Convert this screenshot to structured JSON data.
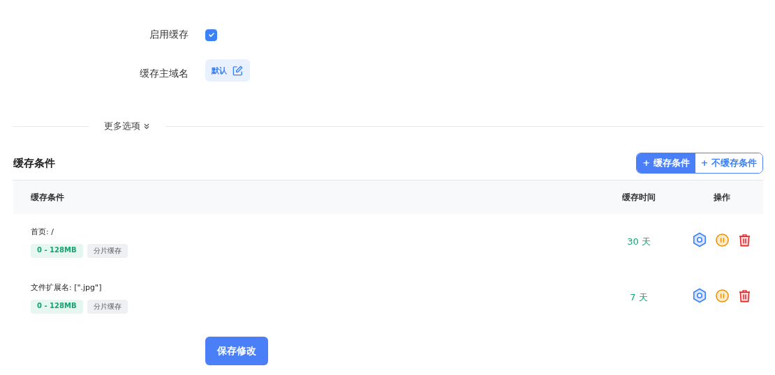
{
  "form": {
    "enable_cache": {
      "label": "启用缓存",
      "checked": true
    },
    "cache_host": {
      "label": "缓存主域名",
      "value": "默认"
    }
  },
  "more_options": {
    "label": "更多选项",
    "expanded": false
  },
  "section": {
    "title": "缓存条件",
    "buttons": [
      {
        "label": "+ 缓存条件",
        "selected": true
      },
      {
        "label": "+ 不缓存条件",
        "selected": false
      }
    ]
  },
  "table": {
    "columns": [
      "缓存条件",
      "缓存时间",
      "操作"
    ],
    "rows": [
      {
        "condition": "首页: /",
        "tags": [
          {
            "label": "0 - 128MB",
            "kind": "size"
          },
          {
            "label": "分片缓存",
            "kind": "plain"
          }
        ],
        "time": "30 天"
      },
      {
        "condition": "文件扩展名: [\".jpg\"]",
        "tags": [
          {
            "label": "0 - 128MB",
            "kind": "size"
          },
          {
            "label": "分片缓存",
            "kind": "plain"
          }
        ],
        "time": "7 天"
      }
    ]
  },
  "save_button": "保存修改"
}
